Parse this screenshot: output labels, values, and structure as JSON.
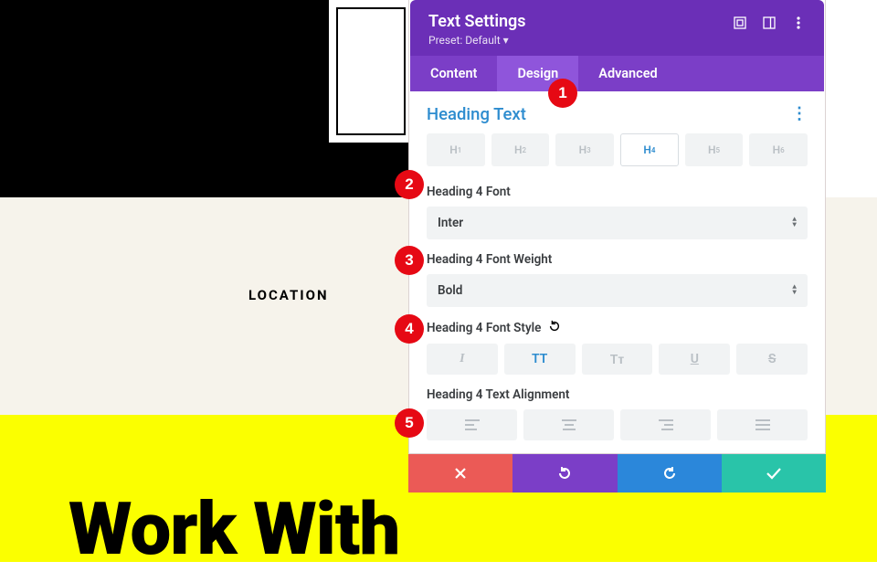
{
  "background": {
    "location_label": "LOCATION",
    "headline": "Work With"
  },
  "panel": {
    "title": "Text Settings",
    "preset": "Preset: Default ▾",
    "tabs": {
      "content": "Content",
      "design": "Design",
      "advanced": "Advanced",
      "active": "design"
    },
    "section": {
      "title": "Heading Text"
    },
    "heading_levels": [
      "H₁",
      "H₂",
      "H₃",
      "H₄",
      "H₅",
      "H₆"
    ],
    "heading_active_index": 3,
    "fields": {
      "font": {
        "label": "Heading 4 Font",
        "value": "Inter"
      },
      "weight": {
        "label": "Heading 4 Font Weight",
        "value": "Bold"
      },
      "style": {
        "label": "Heading 4 Font Style"
      },
      "align": {
        "label": "Heading 4 Text Alignment"
      }
    },
    "style_buttons": {
      "italic": "I",
      "uppercase": "TT",
      "smallcaps": "Tᴛ",
      "underline": "U",
      "strike": "S",
      "active": "uppercase"
    }
  },
  "badges": [
    "1",
    "2",
    "3",
    "4",
    "5"
  ]
}
